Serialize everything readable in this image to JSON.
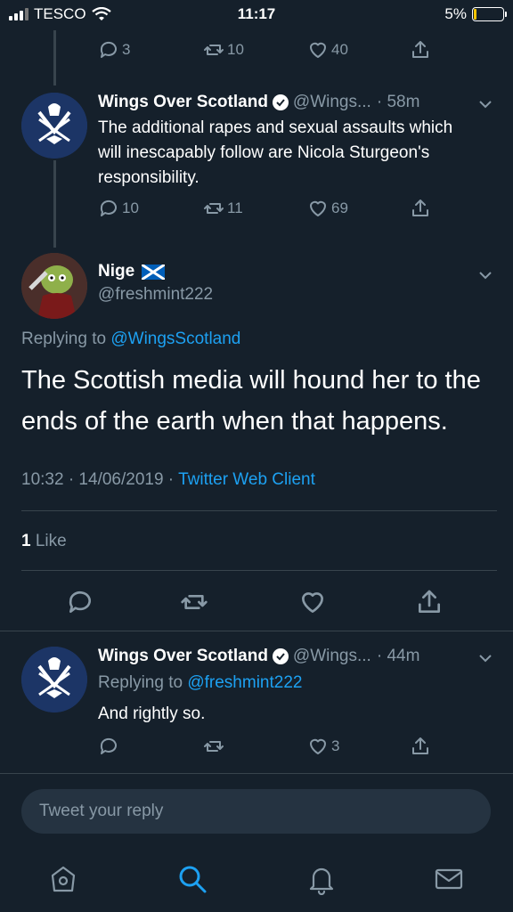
{
  "status_bar": {
    "carrier": "TESCO",
    "time": "11:17",
    "battery_percent": "5%",
    "battery_level": 0.05
  },
  "previous_tweet_actions": {
    "replies": "3",
    "retweets": "10",
    "likes": "40"
  },
  "tweet1": {
    "name": "Wings Over Scotland",
    "handle": "@Wings...",
    "time": "· 58m",
    "text": "The additional rapes and sexual assaults which will inescapably follow are Nicola Sturgeon's responsibility.",
    "replies": "10",
    "retweets": "11",
    "likes": "69"
  },
  "main_tweet": {
    "name": "Nige",
    "flag": "🏴",
    "handle": "@freshmint222",
    "replying_prefix": "Replying to",
    "replying_to": "@WingsScotland",
    "text": "The Scottish media will hound her to the ends of the earth when that happens.",
    "timestamp": "10:32 · 14/06/2019 ·",
    "client": "Twitter Web Client",
    "like_count": "1",
    "like_label": "Like"
  },
  "tweet2": {
    "name": "Wings Over Scotland",
    "handle": "@Wings...",
    "time": "· 44m",
    "replying_prefix": "Replying to",
    "replying_to": "@freshmint222",
    "text": "And rightly so.",
    "likes": "3"
  },
  "reply_box": {
    "placeholder": "Tweet your reply"
  },
  "tabs": [
    "home",
    "search",
    "notifications",
    "messages"
  ],
  "colors": {
    "background": "#15202b",
    "accent": "#1da1f2",
    "muted": "#8899a6",
    "divider": "#38444d",
    "battery": "#f5c400"
  }
}
